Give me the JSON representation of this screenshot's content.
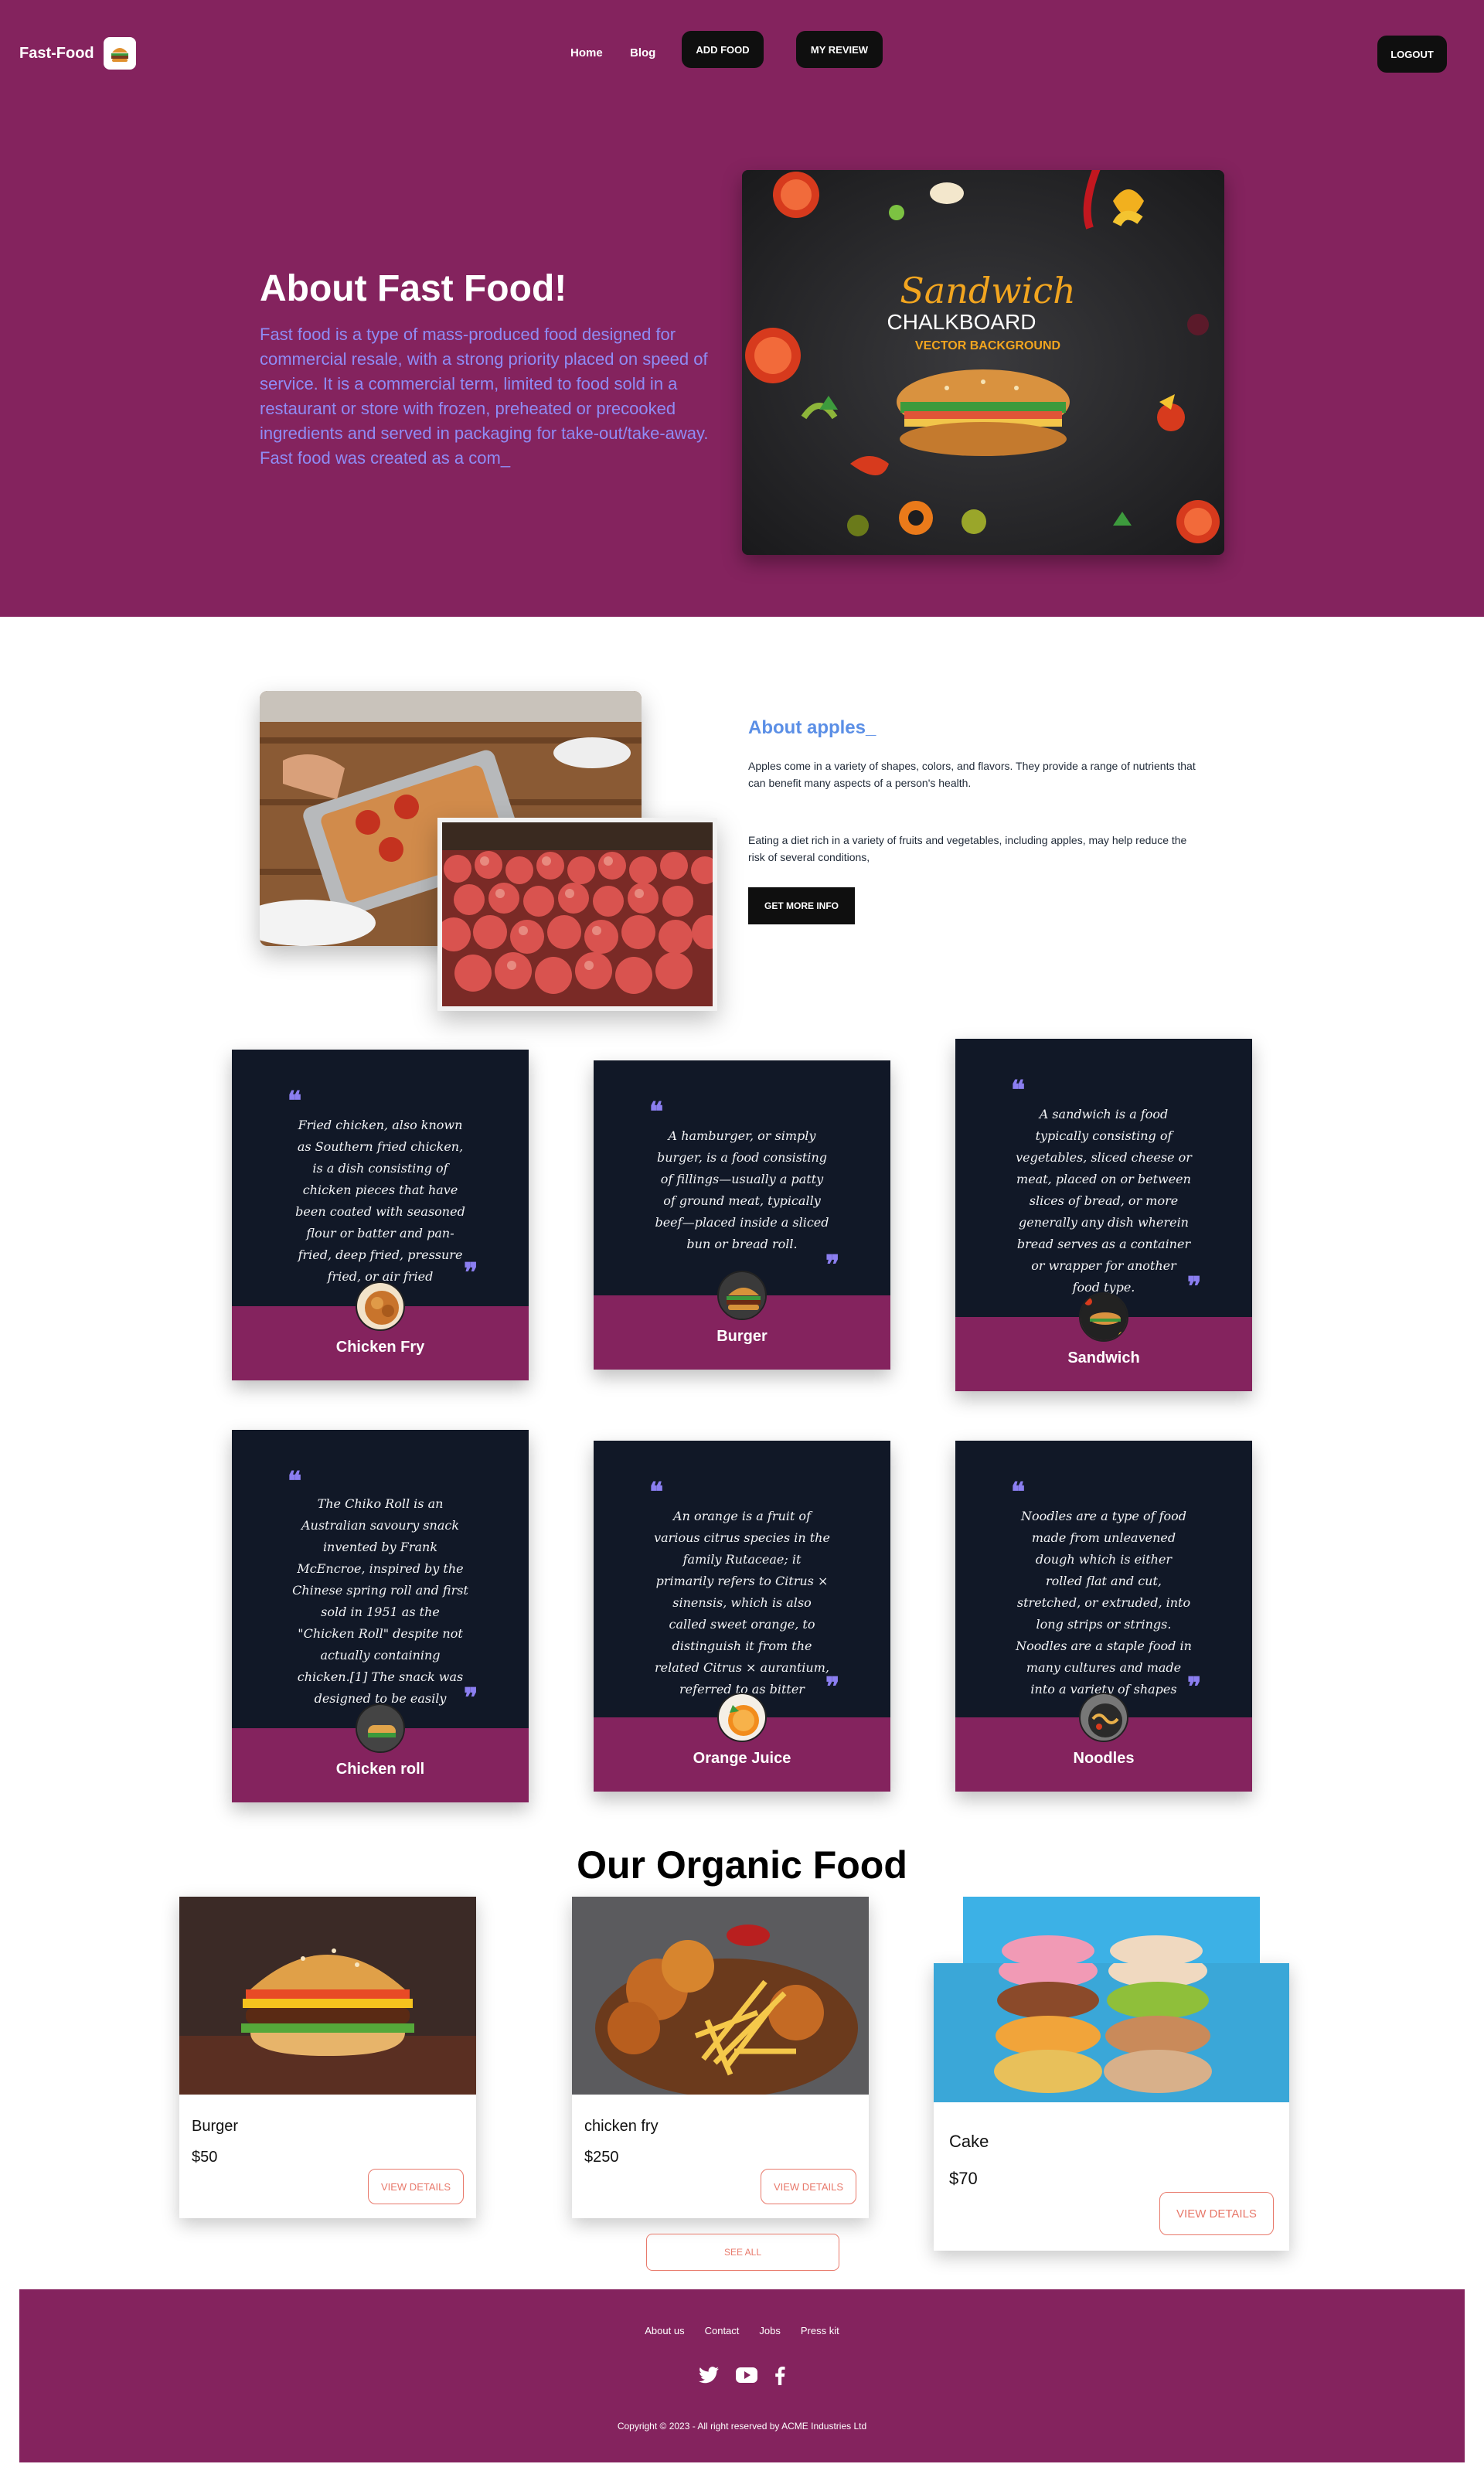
{
  "nav": {
    "brand": "Fast-Food",
    "links": [
      "Home",
      "Blog"
    ],
    "add_food": "ADD FOOD",
    "my_review": "MY REVIEW",
    "logout": "LOGOUT"
  },
  "hero": {
    "title": "About Fast Food!",
    "text": "Fast food is a type of mass-produced food designed for commercial resale, with a strong priority placed on speed of service. It is a commercial term, limited to food sold in a restaurant or store with frozen, preheated or precooked ingredients and served in packaging for take-out/take-away. Fast food was created as a com_",
    "image": {
      "line1": "Sandwich",
      "line2": "CHALKBOARD",
      "line3": "VECTOR BACKGROUND"
    }
  },
  "about": {
    "title": "About apples_",
    "p1": "Apples come in a variety of shapes, colors, and flavors. They provide a range of nutrients that can benefit many aspects of a person's health.",
    "p2": "Eating a diet rich in a variety of fruits and vegetables, including apples, may help reduce the risk of several conditions,",
    "button": "GET MORE INFO"
  },
  "reviews": [
    {
      "name": "Chicken Fry",
      "text": "Fried chicken, also known as Southern fried chicken, is a dish consisting of chicken pieces that have been coated with seasoned flour or batter and pan-fried, deep fried, pressure fried, or air fried"
    },
    {
      "name": "Burger",
      "text": "A hamburger, or simply burger, is a food consisting of fillings—usually a patty of ground meat, typically beef—placed inside a sliced bun or bread roll."
    },
    {
      "name": "Sandwich",
      "text": "A sandwich is a food typically consisting of vegetables, sliced cheese or meat, placed on or between slices of bread, or more generally any dish wherein bread serves as a container or wrapper for another food type."
    },
    {
      "name": "Chicken roll",
      "text": "The Chiko Roll is an Australian savoury snack invented by Frank McEncroe, inspired by the Chinese spring roll and first sold in 1951 as the \"Chicken Roll\" despite not actually containing chicken.[1] The snack was designed to be easily"
    },
    {
      "name": "Orange Juice",
      "text": "An orange is a fruit of various citrus species in the family Rutaceae; it primarily refers to Citrus × sinensis, which is also called sweet orange, to distinguish it from the related Citrus × aurantium, referred to as bitter orange."
    },
    {
      "name": "Noodles",
      "text": "Noodles are a type of food made from unleavened dough which is either rolled flat and cut, stretched, or extruded, into long strips or strings. Noodles are a staple food in many cultures and made into a variety of shapes"
    }
  ],
  "organic": {
    "title": "Our Organic Food",
    "products": [
      {
        "name": "Burger",
        "price": "$50",
        "button": "VIEW DETAILS"
      },
      {
        "name": "chicken fry",
        "price": "$250",
        "button": "VIEW DETAILS"
      },
      {
        "name": "Cake",
        "price": "$70",
        "button": "VIEW DETAILS"
      }
    ],
    "see_all": "SEE ALL"
  },
  "footer": {
    "links": [
      "About us",
      "Contact",
      "Jobs",
      "Press kit"
    ],
    "social_icons": [
      "twitter-icon",
      "youtube-icon",
      "facebook-icon"
    ],
    "copyright": "Copyright © 2023 - All right reserved by ACME Industries Ltd"
  },
  "colors": {
    "brand": "#84235e",
    "dark": "#111827",
    "accent_text": "#8f8cf5",
    "link_blue": "#5b8fe6",
    "button_outline": "#e8796b"
  }
}
